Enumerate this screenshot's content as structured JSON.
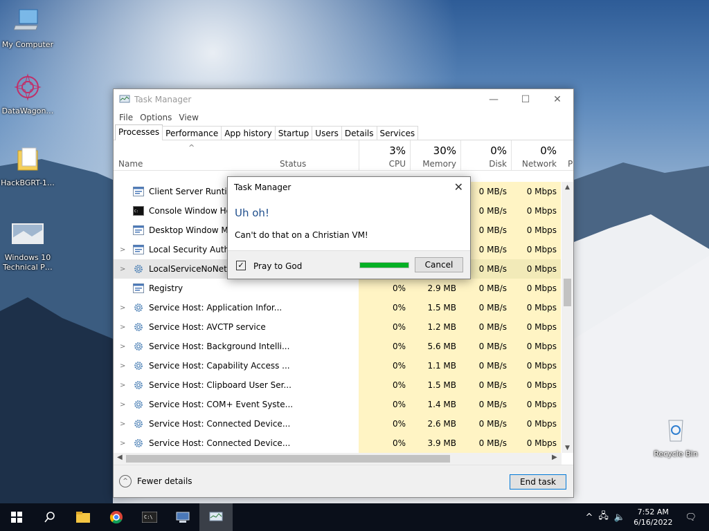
{
  "desktop": {
    "icons": [
      {
        "label": "My Computer",
        "icon": "computer-icon"
      },
      {
        "label": "DataWagon…",
        "icon": "mandala-icon"
      },
      {
        "label": "HackBGRT-1…",
        "icon": "folder-icon"
      },
      {
        "label": "Windows 10 Technical P…",
        "icon": "image-icon"
      },
      {
        "label": "Recycle Bin",
        "icon": "recycle-bin-icon"
      }
    ]
  },
  "window": {
    "title": "Task Manager",
    "menu": [
      "File",
      "Options",
      "View"
    ],
    "tabs": [
      "Processes",
      "Performance",
      "App history",
      "Startup",
      "Users",
      "Details",
      "Services"
    ],
    "columns": {
      "name": "Name",
      "status": "Status",
      "cpu": {
        "pct": "3%",
        "label": "CPU"
      },
      "memory": {
        "pct": "30%",
        "label": "Memory"
      },
      "disk": {
        "pct": "0%",
        "label": "Disk"
      },
      "network": {
        "pct": "0%",
        "label": "Network"
      },
      "power": "P"
    },
    "rows": [
      {
        "name": "Client Server Runtime",
        "cpu": "",
        "mem": "",
        "disk": "0 MB/s",
        "net": "0 Mbps",
        "expand": false
      },
      {
        "name": "Console Window Hos",
        "cpu": "",
        "mem": "",
        "disk": "0 MB/s",
        "net": "0 Mbps",
        "expand": false
      },
      {
        "name": "Desktop Window Mar",
        "cpu": "",
        "mem": "",
        "disk": "0 MB/s",
        "net": "0 Mbps",
        "expand": false
      },
      {
        "name": "Local Security Author",
        "cpu": "",
        "mem": "",
        "disk": "0 MB/s",
        "net": "0 Mbps",
        "expand": true
      },
      {
        "name": "LocalServiceNoNetwo",
        "cpu": "",
        "mem": "",
        "disk": "0 MB/s",
        "net": "0 Mbps",
        "expand": true
      },
      {
        "name": "Registry",
        "cpu": "0%",
        "mem": "2.9 MB",
        "disk": "0 MB/s",
        "net": "0 Mbps",
        "expand": false
      },
      {
        "name": "Service Host: Application Infor...",
        "cpu": "0%",
        "mem": "1.5 MB",
        "disk": "0 MB/s",
        "net": "0 Mbps",
        "expand": true
      },
      {
        "name": "Service Host: AVCTP service",
        "cpu": "0%",
        "mem": "1.2 MB",
        "disk": "0 MB/s",
        "net": "0 Mbps",
        "expand": true
      },
      {
        "name": "Service Host: Background Intelli...",
        "cpu": "0%",
        "mem": "5.6 MB",
        "disk": "0 MB/s",
        "net": "0 Mbps",
        "expand": true
      },
      {
        "name": "Service Host: Capability Access ...",
        "cpu": "0%",
        "mem": "1.1 MB",
        "disk": "0 MB/s",
        "net": "0 Mbps",
        "expand": true
      },
      {
        "name": "Service Host: Clipboard User Ser...",
        "cpu": "0%",
        "mem": "1.5 MB",
        "disk": "0 MB/s",
        "net": "0 Mbps",
        "expand": true
      },
      {
        "name": "Service Host: COM+ Event Syste...",
        "cpu": "0%",
        "mem": "1.4 MB",
        "disk": "0 MB/s",
        "net": "0 Mbps",
        "expand": true
      },
      {
        "name": "Service Host: Connected Device...",
        "cpu": "0%",
        "mem": "2.6 MB",
        "disk": "0 MB/s",
        "net": "0 Mbps",
        "expand": true
      },
      {
        "name": "Service Host: Connected Device...",
        "cpu": "0%",
        "mem": "3.9 MB",
        "disk": "0 MB/s",
        "net": "0 Mbps",
        "expand": true
      }
    ],
    "footer": {
      "fewer_details": "Fewer details",
      "end_task": "End task"
    }
  },
  "dialog": {
    "title": "Task Manager",
    "heading": "Uh oh!",
    "message": "Can't do that on a Christian VM!",
    "checkbox_label": "Pray to God",
    "checkbox_checked": true,
    "progress": 1.0,
    "cancel": "Cancel"
  },
  "taskbar": {
    "icons": [
      "windows-start-icon",
      "search-icon",
      "file-explorer-icon",
      "chrome-icon",
      "cmd-icon",
      "network-app-icon",
      "task-manager-icon"
    ],
    "time": "7:52 AM",
    "date": "6/16/2022"
  }
}
